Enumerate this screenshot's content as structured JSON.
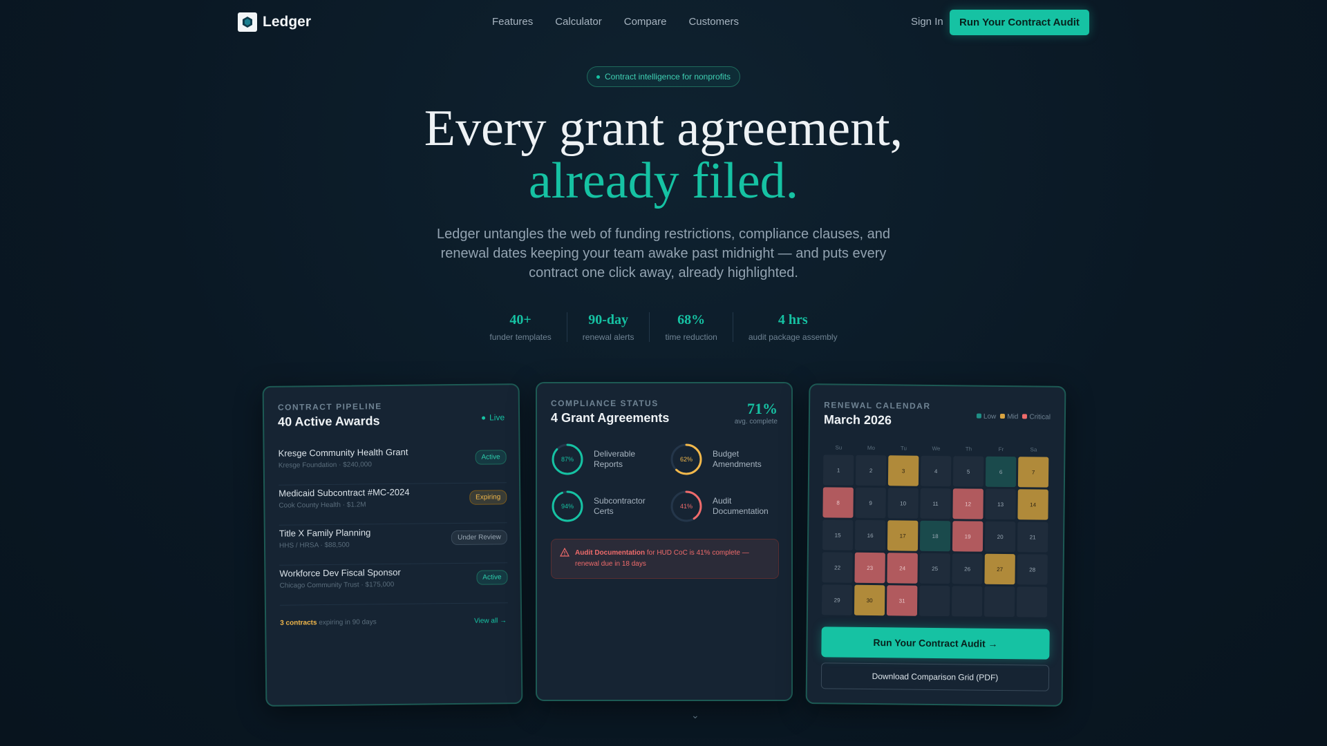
{
  "nav": {
    "brand": "Ledger",
    "links": [
      "Features",
      "Calculator",
      "Compare",
      "Customers"
    ],
    "signin": "Sign In",
    "cta": "Run Your Contract Audit"
  },
  "hero": {
    "pill": "Contract intelligence for nonprofits",
    "title_line1": "Every grant agreement,",
    "title_line2": "already filed.",
    "subtitle": "Ledger untangles the web of funding restrictions, compliance clauses, and renewal dates keeping your team awake past midnight — and puts every contract one click away, already highlighted.",
    "stats": [
      {
        "value": "40+",
        "label": "funder templates"
      },
      {
        "value": "90-day",
        "label": "renewal alerts"
      },
      {
        "value": "68%",
        "label": "time reduction"
      },
      {
        "value": "4 hrs",
        "label": "audit package assembly"
      }
    ]
  },
  "pipeline": {
    "title": "CONTRACT PIPELINE",
    "heading": "40 Active Awards",
    "live": "Live",
    "rows": [
      {
        "name": "Kresge Community Health Grant",
        "meta": "Kresge Foundation · $240,000",
        "status": "Active"
      },
      {
        "name": "Medicaid Subcontract #MC-2024",
        "meta": "Cook County Health · $1.2M",
        "status": "Expiring"
      },
      {
        "name": "Title X Family Planning",
        "meta": "HHS / HRSA · $88,500",
        "status": "Under Review"
      },
      {
        "name": "Workforce Dev Fiscal Sponsor",
        "meta": "Chicago Community Trust · $175,000",
        "status": "Active"
      }
    ],
    "footer_count": "3 contracts",
    "footer_text": "expiring in 90 days",
    "view_all": "View all →"
  },
  "compliance": {
    "title": "COMPLIANCE STATUS",
    "heading": "4 Grant Agreements",
    "pct": "71%",
    "pct_label": "avg. complete",
    "items": [
      {
        "value": 87,
        "label_line1": "Deliverable",
        "label_line2": "Reports",
        "color": "#16c2a3"
      },
      {
        "value": 62,
        "label_line1": "Budget",
        "label_line2": "Amendments",
        "color": "#f2b84b"
      },
      {
        "value": 94,
        "label_line1": "Subcontractor",
        "label_line2": "Certs",
        "color": "#16c2a3"
      },
      {
        "value": 41,
        "label_line1": "Audit",
        "label_line2": "Documentation",
        "color": "#ef6b6b"
      }
    ],
    "alert_bold": "Audit Documentation",
    "alert_text": " for HUD CoC is 41% complete — renewal due in 18 days"
  },
  "calendar": {
    "title": "RENEWAL CALENDAR",
    "heading": "March 2026",
    "legend": [
      "Low",
      "Mid",
      "Critical"
    ],
    "legend_colors": [
      "#1f8f86",
      "#d9a441",
      "#ef6b6b"
    ],
    "weekdays": [
      "Su",
      "Mo",
      "Tu",
      "We",
      "Th",
      "Fr",
      "Sa"
    ],
    "days": [
      {
        "d": "1",
        "t": ""
      },
      {
        "d": "2",
        "t": ""
      },
      {
        "d": "3",
        "t": "mid"
      },
      {
        "d": "4",
        "t": ""
      },
      {
        "d": "5",
        "t": ""
      },
      {
        "d": "6",
        "t": "low"
      },
      {
        "d": "7",
        "t": "mid"
      },
      {
        "d": "8",
        "t": "crit"
      },
      {
        "d": "9",
        "t": ""
      },
      {
        "d": "10",
        "t": ""
      },
      {
        "d": "11",
        "t": ""
      },
      {
        "d": "12",
        "t": "crit"
      },
      {
        "d": "13",
        "t": ""
      },
      {
        "d": "14",
        "t": "mid"
      },
      {
        "d": "15",
        "t": ""
      },
      {
        "d": "16",
        "t": ""
      },
      {
        "d": "17",
        "t": "mid"
      },
      {
        "d": "18",
        "t": "low"
      },
      {
        "d": "19",
        "t": "crit"
      },
      {
        "d": "20",
        "t": ""
      },
      {
        "d": "21",
        "t": ""
      },
      {
        "d": "22",
        "t": ""
      },
      {
        "d": "23",
        "t": "crit"
      },
      {
        "d": "24",
        "t": "crit"
      },
      {
        "d": "25",
        "t": ""
      },
      {
        "d": "26",
        "t": ""
      },
      {
        "d": "27",
        "t": "mid"
      },
      {
        "d": "28",
        "t": ""
      },
      {
        "d": "29",
        "t": ""
      },
      {
        "d": "30",
        "t": "mid"
      },
      {
        "d": "31",
        "t": "crit"
      },
      {
        "d": "",
        "t": ""
      },
      {
        "d": "",
        "t": ""
      },
      {
        "d": "",
        "t": ""
      },
      {
        "d": "",
        "t": ""
      }
    ],
    "cta": "Run Your Contract Audit →",
    "pdf": "Download Comparison Grid (PDF)"
  }
}
